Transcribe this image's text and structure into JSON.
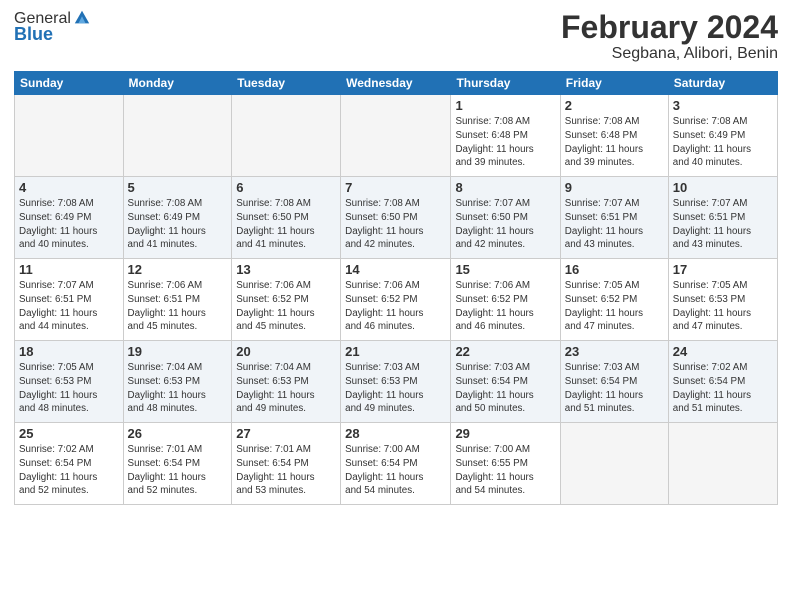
{
  "header": {
    "logo_general": "General",
    "logo_blue": "Blue",
    "month_title": "February 2024",
    "location": "Segbana, Alibori, Benin"
  },
  "weekdays": [
    "Sunday",
    "Monday",
    "Tuesday",
    "Wednesday",
    "Thursday",
    "Friday",
    "Saturday"
  ],
  "weeks": [
    [
      {
        "day": "",
        "info": ""
      },
      {
        "day": "",
        "info": ""
      },
      {
        "day": "",
        "info": ""
      },
      {
        "day": "",
        "info": ""
      },
      {
        "day": "1",
        "info": "Sunrise: 7:08 AM\nSunset: 6:48 PM\nDaylight: 11 hours\nand 39 minutes."
      },
      {
        "day": "2",
        "info": "Sunrise: 7:08 AM\nSunset: 6:48 PM\nDaylight: 11 hours\nand 39 minutes."
      },
      {
        "day": "3",
        "info": "Sunrise: 7:08 AM\nSunset: 6:49 PM\nDaylight: 11 hours\nand 40 minutes."
      }
    ],
    [
      {
        "day": "4",
        "info": "Sunrise: 7:08 AM\nSunset: 6:49 PM\nDaylight: 11 hours\nand 40 minutes."
      },
      {
        "day": "5",
        "info": "Sunrise: 7:08 AM\nSunset: 6:49 PM\nDaylight: 11 hours\nand 41 minutes."
      },
      {
        "day": "6",
        "info": "Sunrise: 7:08 AM\nSunset: 6:50 PM\nDaylight: 11 hours\nand 41 minutes."
      },
      {
        "day": "7",
        "info": "Sunrise: 7:08 AM\nSunset: 6:50 PM\nDaylight: 11 hours\nand 42 minutes."
      },
      {
        "day": "8",
        "info": "Sunrise: 7:07 AM\nSunset: 6:50 PM\nDaylight: 11 hours\nand 42 minutes."
      },
      {
        "day": "9",
        "info": "Sunrise: 7:07 AM\nSunset: 6:51 PM\nDaylight: 11 hours\nand 43 minutes."
      },
      {
        "day": "10",
        "info": "Sunrise: 7:07 AM\nSunset: 6:51 PM\nDaylight: 11 hours\nand 43 minutes."
      }
    ],
    [
      {
        "day": "11",
        "info": "Sunrise: 7:07 AM\nSunset: 6:51 PM\nDaylight: 11 hours\nand 44 minutes."
      },
      {
        "day": "12",
        "info": "Sunrise: 7:06 AM\nSunset: 6:51 PM\nDaylight: 11 hours\nand 45 minutes."
      },
      {
        "day": "13",
        "info": "Sunrise: 7:06 AM\nSunset: 6:52 PM\nDaylight: 11 hours\nand 45 minutes."
      },
      {
        "day": "14",
        "info": "Sunrise: 7:06 AM\nSunset: 6:52 PM\nDaylight: 11 hours\nand 46 minutes."
      },
      {
        "day": "15",
        "info": "Sunrise: 7:06 AM\nSunset: 6:52 PM\nDaylight: 11 hours\nand 46 minutes."
      },
      {
        "day": "16",
        "info": "Sunrise: 7:05 AM\nSunset: 6:52 PM\nDaylight: 11 hours\nand 47 minutes."
      },
      {
        "day": "17",
        "info": "Sunrise: 7:05 AM\nSunset: 6:53 PM\nDaylight: 11 hours\nand 47 minutes."
      }
    ],
    [
      {
        "day": "18",
        "info": "Sunrise: 7:05 AM\nSunset: 6:53 PM\nDaylight: 11 hours\nand 48 minutes."
      },
      {
        "day": "19",
        "info": "Sunrise: 7:04 AM\nSunset: 6:53 PM\nDaylight: 11 hours\nand 48 minutes."
      },
      {
        "day": "20",
        "info": "Sunrise: 7:04 AM\nSunset: 6:53 PM\nDaylight: 11 hours\nand 49 minutes."
      },
      {
        "day": "21",
        "info": "Sunrise: 7:03 AM\nSunset: 6:53 PM\nDaylight: 11 hours\nand 49 minutes."
      },
      {
        "day": "22",
        "info": "Sunrise: 7:03 AM\nSunset: 6:54 PM\nDaylight: 11 hours\nand 50 minutes."
      },
      {
        "day": "23",
        "info": "Sunrise: 7:03 AM\nSunset: 6:54 PM\nDaylight: 11 hours\nand 51 minutes."
      },
      {
        "day": "24",
        "info": "Sunrise: 7:02 AM\nSunset: 6:54 PM\nDaylight: 11 hours\nand 51 minutes."
      }
    ],
    [
      {
        "day": "25",
        "info": "Sunrise: 7:02 AM\nSunset: 6:54 PM\nDaylight: 11 hours\nand 52 minutes."
      },
      {
        "day": "26",
        "info": "Sunrise: 7:01 AM\nSunset: 6:54 PM\nDaylight: 11 hours\nand 52 minutes."
      },
      {
        "day": "27",
        "info": "Sunrise: 7:01 AM\nSunset: 6:54 PM\nDaylight: 11 hours\nand 53 minutes."
      },
      {
        "day": "28",
        "info": "Sunrise: 7:00 AM\nSunset: 6:54 PM\nDaylight: 11 hours\nand 54 minutes."
      },
      {
        "day": "29",
        "info": "Sunrise: 7:00 AM\nSunset: 6:55 PM\nDaylight: 11 hours\nand 54 minutes."
      },
      {
        "day": "",
        "info": ""
      },
      {
        "day": "",
        "info": ""
      }
    ]
  ]
}
